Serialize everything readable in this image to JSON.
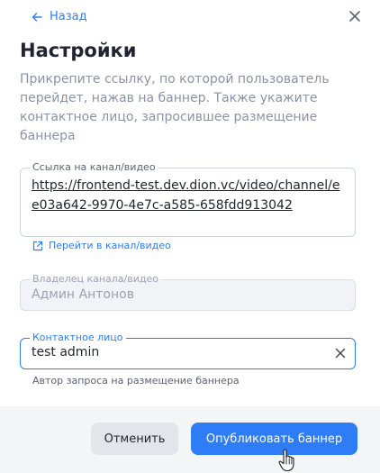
{
  "header": {
    "back_label": "Назад",
    "back_icon": "arrow-left-icon",
    "close_icon": "close-icon"
  },
  "title": "Настройки",
  "description": "Прикрепите ссылку, по которой пользователь перейдет, нажав на баннер. Также укажите контактное лицо, запросившее размещение баннера",
  "url_field": {
    "label": "Ссылка на канал/видео",
    "value": "https://frontend-test.dev.dion.vc/video/channel/ee03a642-9970-4e7c-a585-658fdd913042"
  },
  "channel_link": {
    "label": "Перейти в канал/видео",
    "icon": "external-link-icon"
  },
  "owner_field": {
    "label": "Владелец канала/видео",
    "value": "Админ Антонов"
  },
  "contact_field": {
    "label": "Контактное лицо",
    "value": "test admin",
    "helper": "Автор запроса на размещение баннера"
  },
  "footer": {
    "cancel_label": "Отменить",
    "publish_label": "Опубликовать баннер"
  },
  "colors": {
    "accent": "#2f7df6",
    "muted_text": "#8a93a5",
    "footer_bg": "#f4f5f7"
  }
}
